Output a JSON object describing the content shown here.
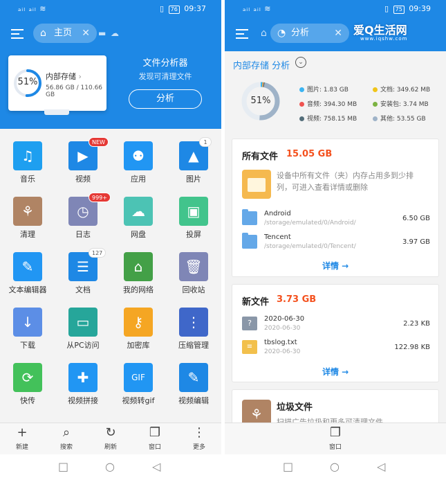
{
  "left": {
    "status": {
      "signal": "ₐᵢₗ ₐᵢₗ ≋",
      "battery": "76",
      "time": "09:37"
    },
    "tab": {
      "label": "主页"
    },
    "storage": {
      "title": "内部存储",
      "percent": "51%",
      "size": "56.86 GB / 110.66 GB"
    },
    "analyzer": {
      "title": "文件分析器",
      "subtitle": "发现可清理文件",
      "button": "分析"
    },
    "grid": [
      {
        "label": "音乐",
        "icon": "music-icon",
        "glyph": "♫",
        "color": "#1e9ff0"
      },
      {
        "label": "视频",
        "icon": "video-icon",
        "glyph": "▶",
        "color": "#1e88e5",
        "badge": "NEW"
      },
      {
        "label": "应用",
        "icon": "android-icon",
        "glyph": "⚉",
        "color": "#2196f3"
      },
      {
        "label": "图片",
        "icon": "picture-icon",
        "glyph": "▲",
        "color": "#1e88e5",
        "badge": "1"
      },
      {
        "label": "清理",
        "icon": "broom-icon",
        "glyph": "⚘",
        "color": "#b08464"
      },
      {
        "label": "日志",
        "icon": "log-icon",
        "glyph": "◷",
        "color": "#7f86b6",
        "badge": "999+"
      },
      {
        "label": "网盘",
        "icon": "cloud-icon",
        "glyph": "☁",
        "color": "#4cc3b4"
      },
      {
        "label": "投屏",
        "icon": "cast-icon",
        "glyph": "▣",
        "color": "#42c48c"
      },
      {
        "label": "文本编辑器",
        "icon": "text-editor-icon",
        "glyph": "✎",
        "color": "#2196f3"
      },
      {
        "label": "文档",
        "icon": "document-icon",
        "glyph": "☰",
        "color": "#1e88e5",
        "badge": "127"
      },
      {
        "label": "我的网络",
        "icon": "network-icon",
        "glyph": "⌂",
        "color": "#43a047"
      },
      {
        "label": "回收站",
        "icon": "trash-icon",
        "glyph": "🗑",
        "color": "#7f86b6"
      },
      {
        "label": "下载",
        "icon": "download-icon",
        "glyph": "↓",
        "color": "#5c8ee6"
      },
      {
        "label": "从PC访问",
        "icon": "pc-access-icon",
        "glyph": "▭",
        "color": "#26a69a"
      },
      {
        "label": "加密库",
        "icon": "lock-icon",
        "glyph": "⚷",
        "color": "#f5a623"
      },
      {
        "label": "压缩管理",
        "icon": "zip-icon",
        "glyph": "⋮",
        "color": "#3f67c9"
      },
      {
        "label": "快传",
        "icon": "transfer-icon",
        "glyph": "⟳",
        "color": "#43c15a"
      },
      {
        "label": "视频拼接",
        "icon": "video-join-icon",
        "glyph": "✚",
        "color": "#2196f3"
      },
      {
        "label": "视频转gif",
        "icon": "gif-icon",
        "glyph": "GIF",
        "color": "#2196f3"
      },
      {
        "label": "视频编辑",
        "icon": "video-edit-icon",
        "glyph": "✎",
        "color": "#1e88e5"
      }
    ],
    "toolbar": [
      {
        "label": "新建",
        "glyph": "+"
      },
      {
        "label": "搜索",
        "glyph": "⌕"
      },
      {
        "label": "刷新",
        "glyph": "↻"
      },
      {
        "label": "窗口",
        "glyph": "❐"
      },
      {
        "label": "更多",
        "glyph": "⋮"
      }
    ]
  },
  "right": {
    "status": {
      "signal": "ₐᵢₗ ₐᵢₗ ≋",
      "battery": "75",
      "time": "09:39"
    },
    "tab": {
      "label": "分析"
    },
    "watermark": {
      "logo": "爱Q生活网",
      "url": "www.iqshw.com"
    },
    "storage_title": "内部存储 分析",
    "summary": {
      "percent": "51%",
      "legend": [
        {
          "label": "图片: 1.83 GB",
          "color": "#3bb4f2"
        },
        {
          "label": "文档: 349.62 MB",
          "color": "#f0c419"
        },
        {
          "label": "音频: 394.30 MB",
          "color": "#ef5350"
        },
        {
          "label": "安装包: 3.74 MB",
          "color": "#7cb342"
        },
        {
          "label": "视频: 758.15 MB",
          "color": "#546e7a"
        },
        {
          "label": "其他: 53.55 GB",
          "color": "#9fb3c8"
        }
      ]
    },
    "all_files": {
      "title": "所有文件",
      "total": "15.05 GB",
      "desc": "设备中所有文件（夹）内存占用多到少排列，可进入查看详情或删除",
      "rows": [
        {
          "name": "Android",
          "path": "/storage/emulated/0/Android/",
          "size": "6.50 GB"
        },
        {
          "name": "Tencent",
          "path": "/storage/emulated/0/Tencent/",
          "size": "3.97 GB"
        }
      ],
      "more": "详情 →"
    },
    "new_files": {
      "title": "新文件",
      "total": "3.73 GB",
      "rows": [
        {
          "name": "2020-06-30",
          "path": "2020-06-30",
          "size": "2.23 KB"
        },
        {
          "name": "tbslog.txt",
          "path": "2020-06-30",
          "size": "122.98 KB"
        }
      ],
      "more": "详情 →"
    },
    "junk": {
      "title": "垃圾文件",
      "desc": "扫描广告垃圾和更多可清理文件"
    },
    "toolbar": [
      {
        "label": "窗口",
        "glyph": "❐"
      }
    ]
  },
  "nav": {
    "square": "□",
    "circle": "○",
    "back": "◁"
  }
}
